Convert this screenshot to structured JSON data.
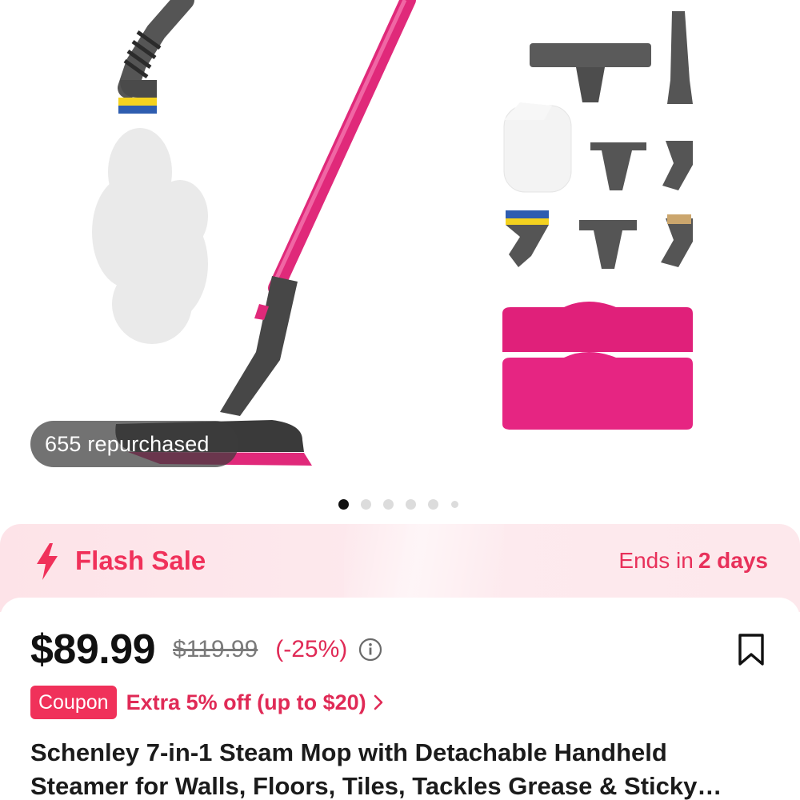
{
  "gallery": {
    "repurchased_label": "655 repurchased",
    "image_count": 6,
    "active_index": 0
  },
  "flash_sale": {
    "label": "Flash Sale",
    "ends_prefix": "Ends in",
    "ends_value": "2 days",
    "icon": "lightning-icon",
    "accent_color": "#f0315a"
  },
  "pricing": {
    "price": "$89.99",
    "original_price": "$119.99",
    "discount": "(-25%)"
  },
  "coupon": {
    "tag": "Coupon",
    "text": "Extra 5% off (up to $20)"
  },
  "product": {
    "title": "Schenley 7-in-1 Steam Mop with Detachable Handheld Steamer for Walls, Floors, Tiles, Tackles Grease & Sticky Messes"
  },
  "icons": {
    "info": "info-icon",
    "bookmark": "bookmark-icon",
    "chevron": "chevron-right-icon"
  }
}
